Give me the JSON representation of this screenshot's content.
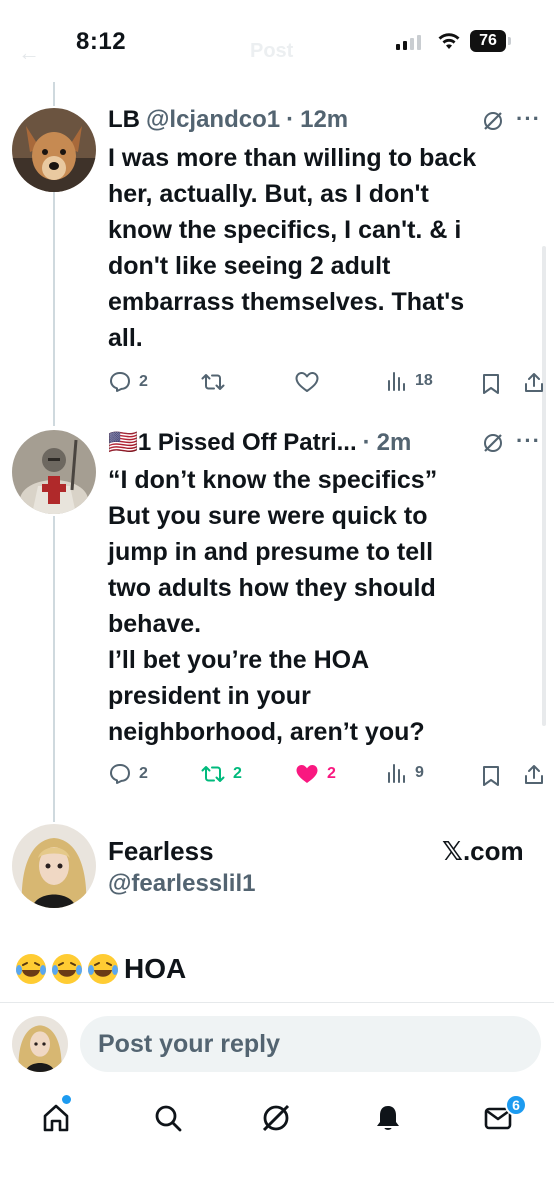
{
  "status_bar": {
    "time": "8:12",
    "battery": "76",
    "ghost_title": "Post"
  },
  "tweets": [
    {
      "name": "LB",
      "handle": "@lcjandco1",
      "separator": "·",
      "time": "12m",
      "avatar_icon": "dog-avatar",
      "lines": [
        "I was more than willing to back",
        "her, actually. But, as I don't",
        "know the specifics, I can't. & i",
        "don't like seeing 2 adult",
        "embarrass themselves. That's",
        "all."
      ],
      "replies": "2",
      "reposts": "",
      "likes": "",
      "views": "18",
      "liked": false
    },
    {
      "name": "🇺🇸1 Pissed Off Patri...",
      "handle": "",
      "separator": "·",
      "time": "2m",
      "avatar_icon": "knight-avatar",
      "lines": [
        "“I don’t know the specifics”",
        "But you sure were quick to",
        "jump in and presume to tell",
        "two adults how they should",
        "behave.",
        "I’ll bet you’re the HOA",
        "president in your",
        "neighborhood, aren’t you?"
      ],
      "replies": "2",
      "reposts": "2",
      "likes": "2",
      "views": "9",
      "liked": true
    }
  ],
  "card": {
    "name": "Fearless",
    "handle": "@fearlesslil1",
    "domain": "𝕏.com",
    "emoji_text": "HOA"
  },
  "reply_bar": {
    "placeholder": "Post your reply"
  },
  "nav": {
    "items": [
      "home-icon",
      "search-icon",
      "grok-icon",
      "notifications-icon",
      "messages-icon"
    ],
    "messages_badge": "6"
  },
  "colors": {
    "text": "#0f1419",
    "secondary": "#536471",
    "like": "#f91880",
    "repost": "#00ba7c",
    "accent": "#1d9bf0"
  }
}
